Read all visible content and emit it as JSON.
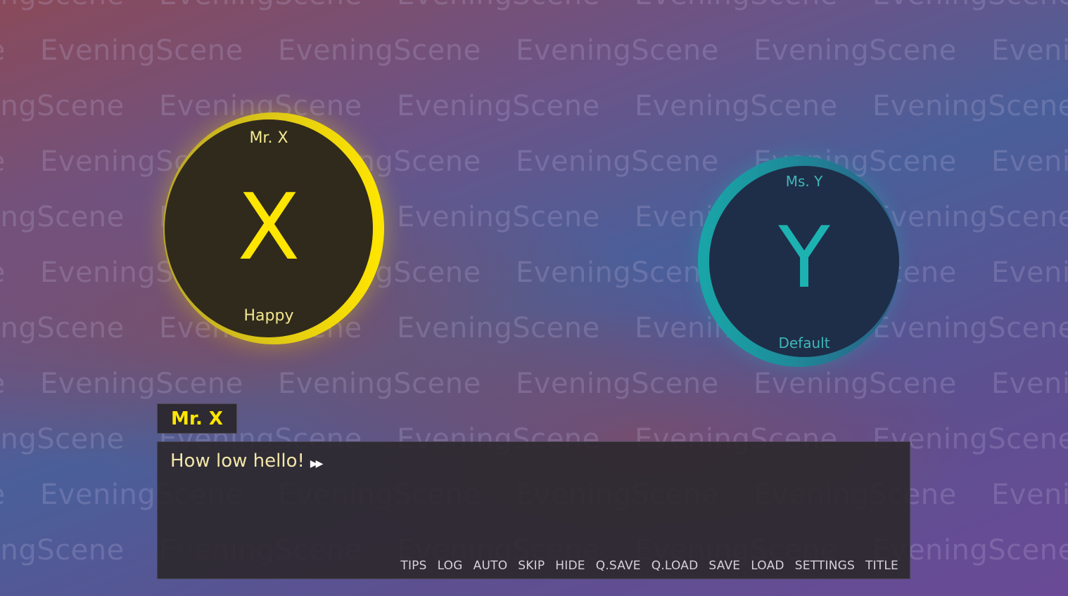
{
  "scene": {
    "watermark_text": "EveningScene"
  },
  "characters": {
    "x": {
      "letter": "X",
      "name": "Mr. X",
      "mood": "Happy",
      "color": "#ffe600"
    },
    "y": {
      "letter": "Y",
      "name": "Ms. Y",
      "mood": "Default",
      "color": "#1cb2b2"
    }
  },
  "dialogue": {
    "speaker": "Mr. X",
    "text": "How low hello!",
    "continue_icon": "fast-forward-icon"
  },
  "quick_menu": {
    "tips": "TIPS",
    "log": "LOG",
    "auto": "AUTO",
    "skip": "SKIP",
    "hide": "HIDE",
    "qsave": "Q.SAVE",
    "qload": "Q.LOAD",
    "save": "SAVE",
    "load": "LOAD",
    "settings": "SETTINGS",
    "title": "TITLE"
  }
}
